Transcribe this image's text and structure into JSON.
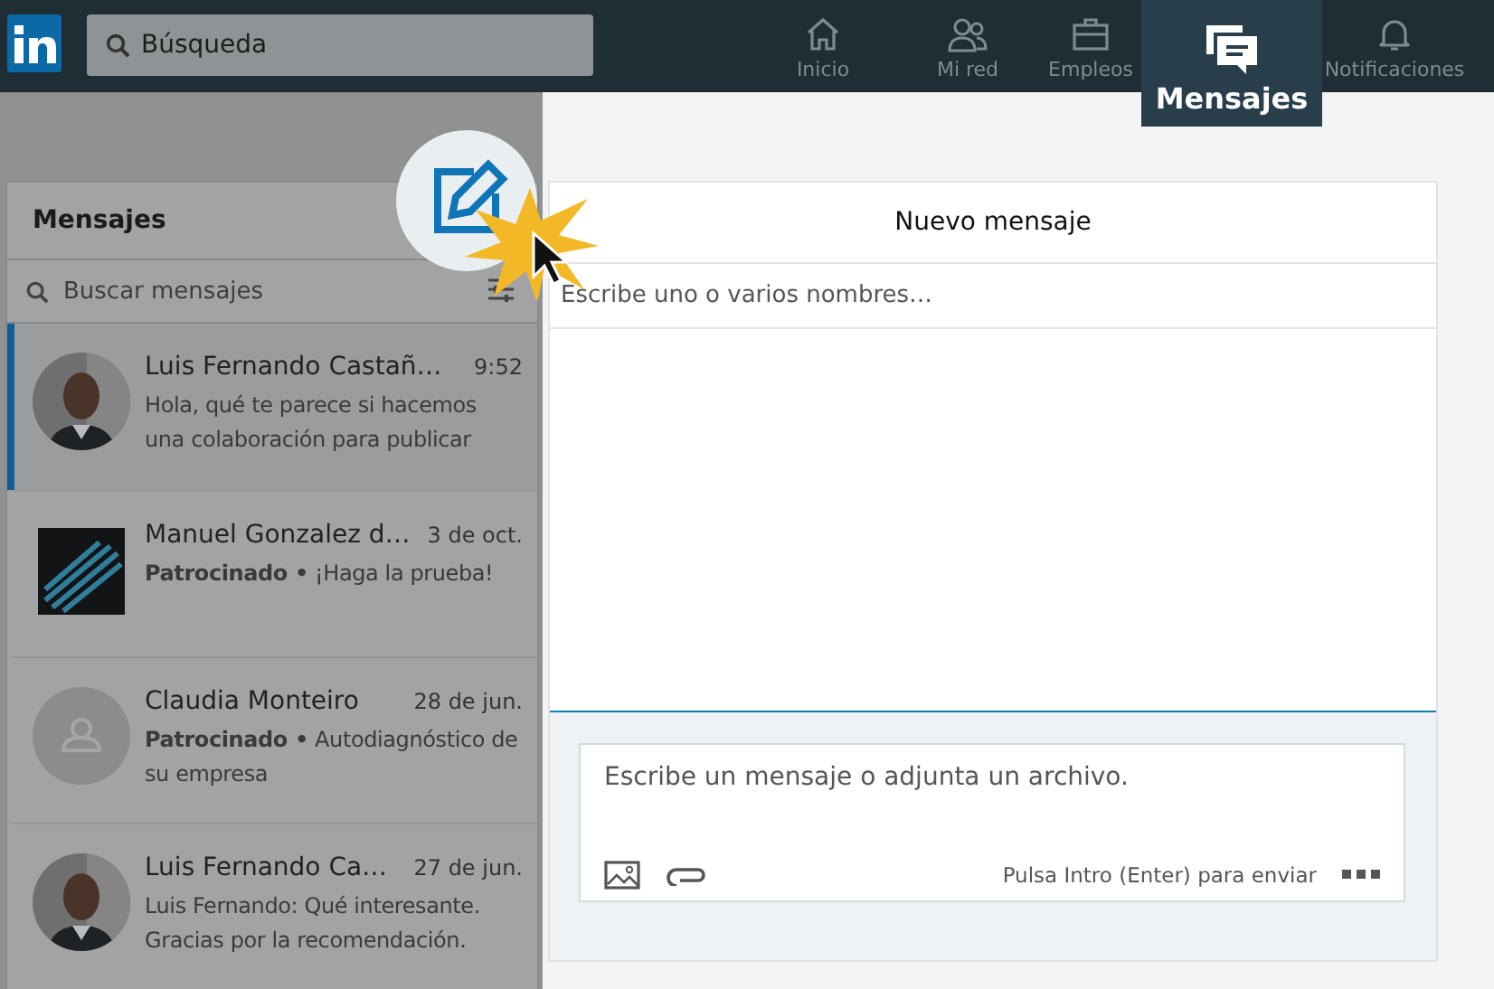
{
  "top_nav": {
    "search": {
      "placeholder": "Búsqueda"
    },
    "items": [
      {
        "kind": "home",
        "label": "Inicio",
        "selected": false
      },
      {
        "kind": "network",
        "label": "Mi red",
        "selected": false
      },
      {
        "kind": "jobs",
        "label": "Empleos",
        "selected": false
      },
      {
        "kind": "messages",
        "label": "Mensajes",
        "selected": true
      },
      {
        "kind": "bell",
        "label": "Notificaciones",
        "selected": false
      }
    ]
  },
  "sidebar": {
    "title": "Mensajes",
    "search": {
      "placeholder": "Buscar mensajes"
    },
    "conversations": [
      {
        "name": "Luis Fernando Castañ…",
        "time": "9:52",
        "preview": "Hola, qué te parece si hacemos una colaboración para publicar",
        "selected": true
      },
      {
        "kind": "logo",
        "name": "Manuel Gonzalez d…",
        "time": "3 de oct.",
        "preview": "**Patrocinado •** ¡Haga la prueba!",
        "selected": false
      },
      {
        "kind": "placeholder",
        "name": "Claudia Monteiro",
        "time": "28 de jun.",
        "preview": "**Patrocinado •** Autodiagnóstico de su empresa",
        "selected": false
      },
      {
        "name": "Luis Fernando Ca…",
        "time": "27 de jun.",
        "preview": "Luis Fernando: Qué interesante. Gracias por la recomendación.",
        "selected": false
      }
    ]
  },
  "new_message": {
    "title": "Nuevo mensaje",
    "recipients": {
      "placeholder": "Escribe uno o varios nombres…"
    },
    "composer": {
      "placeholder": "Escribe un mensaje o adjunta un archivo.",
      "hint": "Pulsa Intro (Enter) para enviar"
    }
  }
}
